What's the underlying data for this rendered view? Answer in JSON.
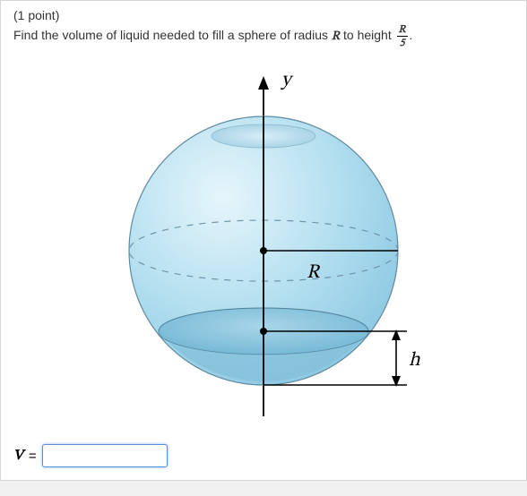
{
  "points": "(1 point)",
  "prompt": {
    "p1": "Find the volume of liquid needed to fill a sphere of radius ",
    "R": "R",
    "p2": " to height ",
    "frac_num": "R",
    "frac_den": "5",
    "p3": "."
  },
  "labels": {
    "y": "y",
    "R": "R",
    "h": "h"
  },
  "answer": {
    "var": "V",
    "eq": "=",
    "value": ""
  }
}
